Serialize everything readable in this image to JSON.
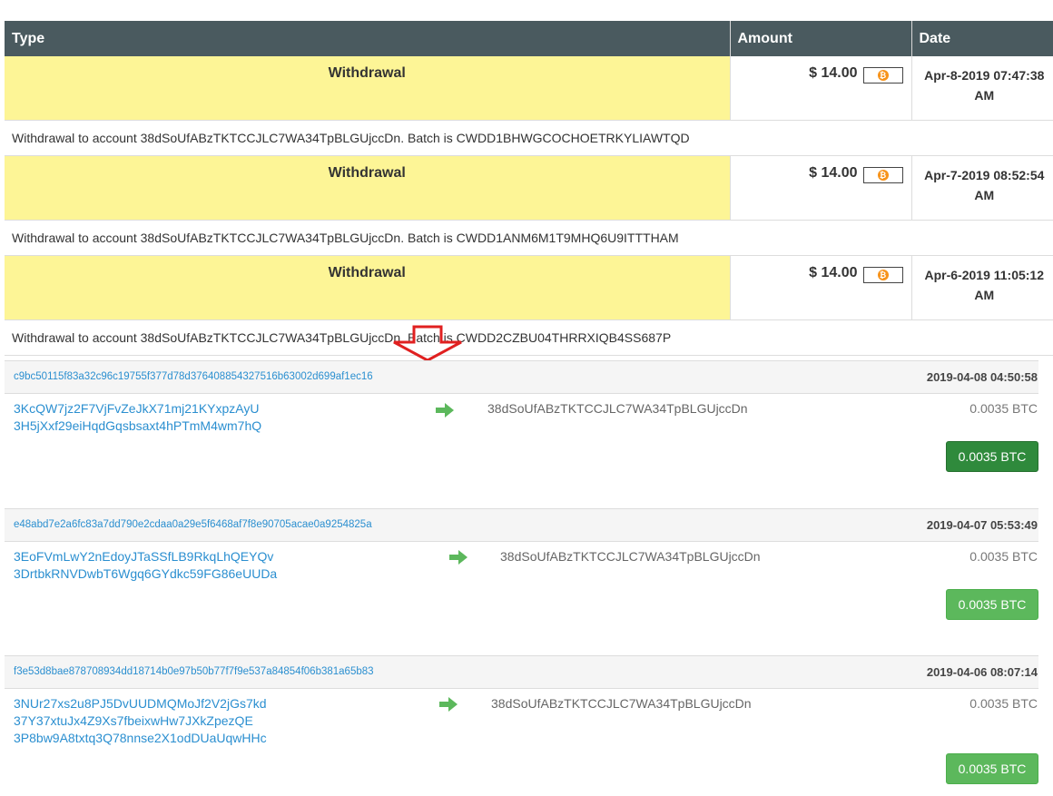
{
  "table": {
    "headers": {
      "type": "Type",
      "amount": "Amount",
      "date": "Date"
    },
    "rows": [
      {
        "type": "Withdrawal",
        "amount": "$ 14.00",
        "date_line1": "Apr-8-2019 07:47:38",
        "date_line2": "AM",
        "description": "Withdrawal to account 38dSoUfABzTKTCCJLC7WA34TpBLGUjccDn. Batch is CWDD1BHWGCOCHOETRKYLIAWTQD"
      },
      {
        "type": "Withdrawal",
        "amount": "$ 14.00",
        "date_line1": "Apr-7-2019 08:52:54",
        "date_line2": "AM",
        "description": "Withdrawal to account 38dSoUfABzTKTCCJLC7WA34TpBLGUjccDn. Batch is CWDD1ANM6M1T9MHQ6U9ITTTHAM"
      },
      {
        "type": "Withdrawal",
        "amount": "$ 14.00",
        "date_line1": "Apr-6-2019 11:05:12",
        "date_line2": "AM",
        "description": "Withdrawal to account 38dSoUfABzTKTCCJLC7WA34TpBLGUjccDn. Batch is CWDD2CZBU04THRRXIQB4SS687P"
      }
    ],
    "coin_icon": "bitcoin-icon",
    "coin_glyph": "₿"
  },
  "transactions": [
    {
      "hash": "c9bc50115f83a32c96c19755f377d78d376408854327516b63002d699af1ec16",
      "time": "2019-04-08 04:50:58",
      "inputs": [
        "3KcQW7jz2F7VjFvZeJkX71mj21KYxpzAyU",
        "3H5jXxf29eiHqdGqsbsaxt4hPTmM4wm7hQ"
      ],
      "destination": "38dSoUfABzTKTCCJLC7WA34TpBLGUjccDn",
      "output_amount": "0.0035 BTC",
      "total": "0.0035 BTC"
    },
    {
      "hash": "e48abd7e2a6fc83a7dd790e2cdaa0a29e5f6468af7f8e90705acae0a9254825a",
      "time": "2019-04-07 05:53:49",
      "inputs": [
        "3EoFVmLwY2nEdoyJTaSSfLB9RkqLhQEYQv",
        "3DrtbkRNVDwbT6Wgq6GYdkc59FG86eUUDa"
      ],
      "destination": "38dSoUfABzTKTCCJLC7WA34TpBLGUjccDn",
      "output_amount": "0.0035 BTC",
      "total": "0.0035 BTC"
    },
    {
      "hash": "f3e53d8bae878708934dd18714b0e97b50b77f7f9e537a84854f06b381a65b83",
      "time": "2019-04-06 08:07:14",
      "inputs": [
        "3NUr27xs2u8PJ5DvUUDMQMoJf2V2jGs7kd",
        "37Y37xtuJx4Z9Xs7fbeixwHw7JXkZpezQE",
        "3P8bw9A8txtq3Q78nnse2X1odDUaUqwHHc"
      ],
      "destination": "38dSoUfABzTKTCCJLC7WA34TpBLGUjccDn",
      "output_amount": "0.0035 BTC",
      "total": "0.0035 BTC"
    }
  ],
  "colors": {
    "header_bg": "#4a5a5f",
    "withdrawal_bg": "#fdf596",
    "link_blue": "#2b8fd0",
    "arrow_red": "#e02020",
    "arrow_green": "#5cb85c"
  }
}
